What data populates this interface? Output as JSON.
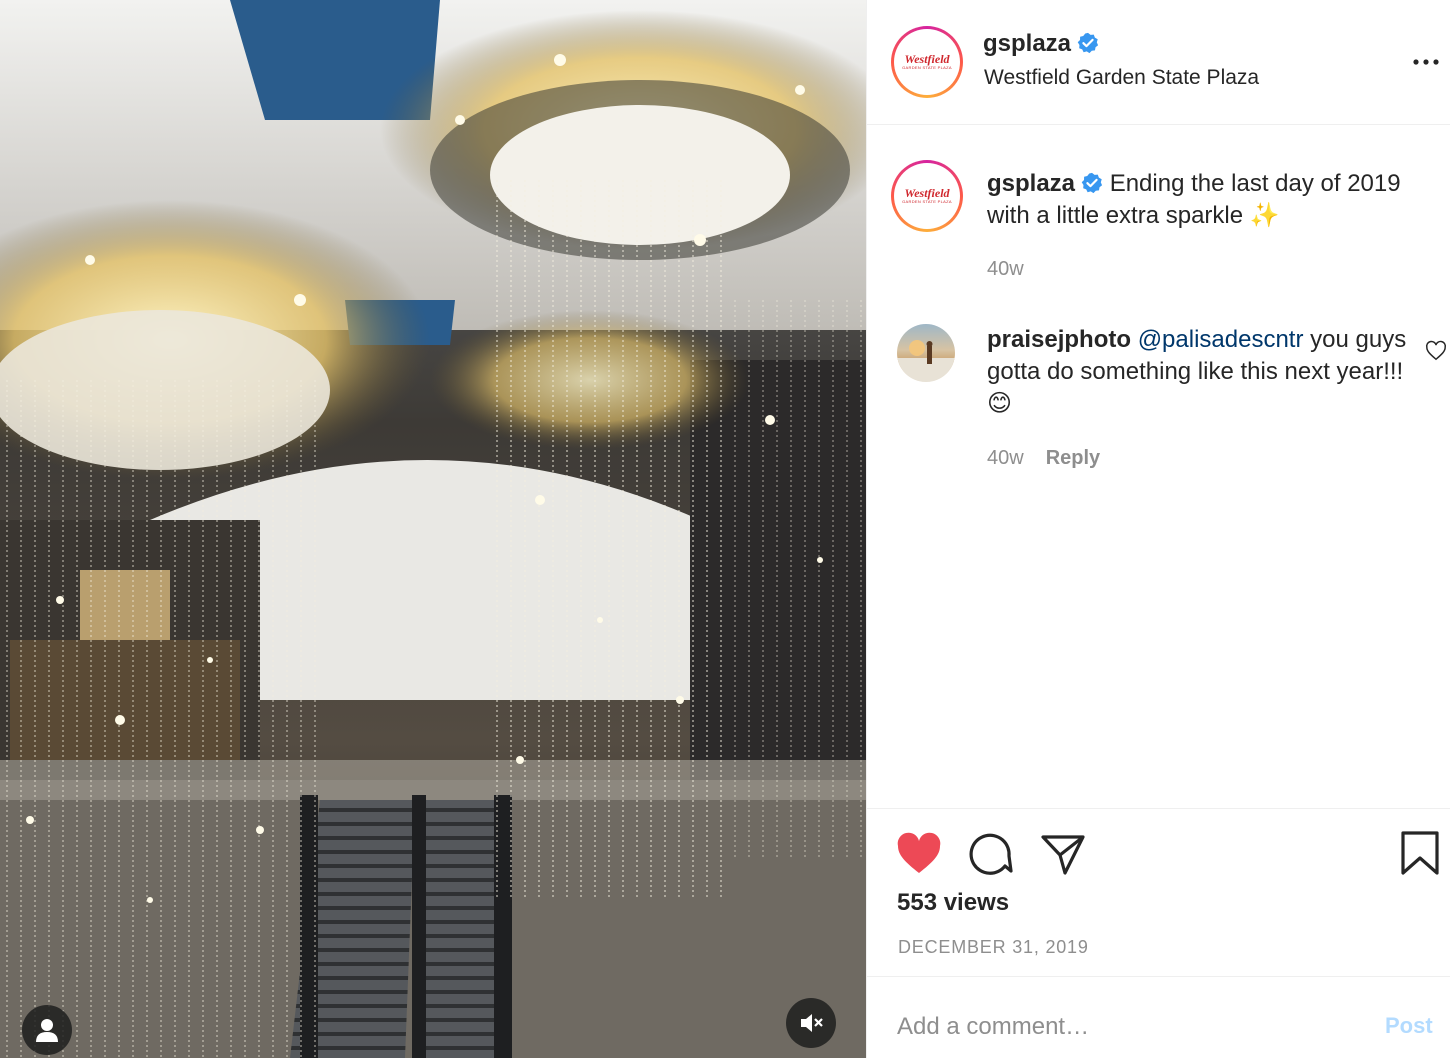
{
  "post": {
    "media_alt": "Holiday light installation inside mall atrium with escalators",
    "account": {
      "username": "gsplaza",
      "location": "Westfield Garden State Plaza",
      "logo_text": "Westfield",
      "logo_subtext": "GARDEN STATE PLAZA"
    },
    "caption": {
      "username": "gsplaza",
      "text": "Ending the last day of 2019 with a little extra sparkle ✨",
      "time": "40w"
    },
    "comments": [
      {
        "username": "praisejphoto",
        "mention": "@palisadescntr",
        "text": "you guys gotta do something like this next year!!! 😊",
        "time": "40w",
        "reply_label": "Reply"
      }
    ],
    "views": "553 views",
    "date": "DECEMBER 31, 2019",
    "add_comment": {
      "placeholder": "Add a comment…",
      "post_label": "Post"
    },
    "colors": {
      "like_red": "#ed4956",
      "verified_blue": "#3897f0",
      "post_disabled": "#b3dbff",
      "secondary_text": "#8e8e8e"
    },
    "icons": [
      "heart-filled-icon",
      "comment-icon",
      "share-icon",
      "bookmark-icon",
      "more-icon",
      "verified-icon",
      "user-icon",
      "mute-icon",
      "heart-outline-icon"
    ]
  }
}
